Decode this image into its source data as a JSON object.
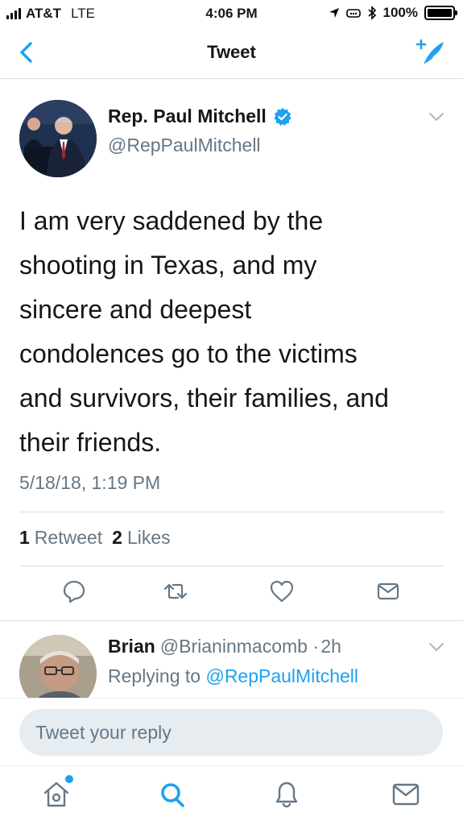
{
  "status_bar": {
    "carrier": "AT&T",
    "network": "LTE",
    "time": "4:06 PM",
    "battery": "100%",
    "battery_level": 1.0
  },
  "nav": {
    "title": "Tweet",
    "back_icon": "chevron-left-icon",
    "compose_icon": "compose-tweet-icon"
  },
  "tweet": {
    "display_name": "Rep. Paul Mitchell",
    "verified": true,
    "handle": "@RepPaulMitchell",
    "text_lines": [
      "I am very saddened by the",
      "shooting in Texas, and my",
      "sincere and deepest",
      "condolences go to the victims",
      "and survivors, their families, and",
      "their friends."
    ],
    "timestamp": "5/18/18, 1:19 PM",
    "retweet_count": "1",
    "retweet_label": "Retweet",
    "like_count": "2",
    "like_label": "Likes"
  },
  "actions": [
    "reply-icon",
    "retweet-icon",
    "like-icon",
    "direct-message-icon"
  ],
  "reply": {
    "name": "Brian",
    "handle": "@Brianinmacomb",
    "separator": "·",
    "time": "2h",
    "replying_prefix": "Replying to",
    "replying_to": "@RepPaulMitchell"
  },
  "compose": {
    "placeholder": "Tweet your reply"
  },
  "tab_bar": [
    "home-icon",
    "search-icon",
    "notifications-icon",
    "messages-icon"
  ],
  "colors": {
    "accent": "#1da1f2",
    "text_primary": "#14171a",
    "text_secondary": "#657786",
    "divider": "#d9dfe4"
  }
}
